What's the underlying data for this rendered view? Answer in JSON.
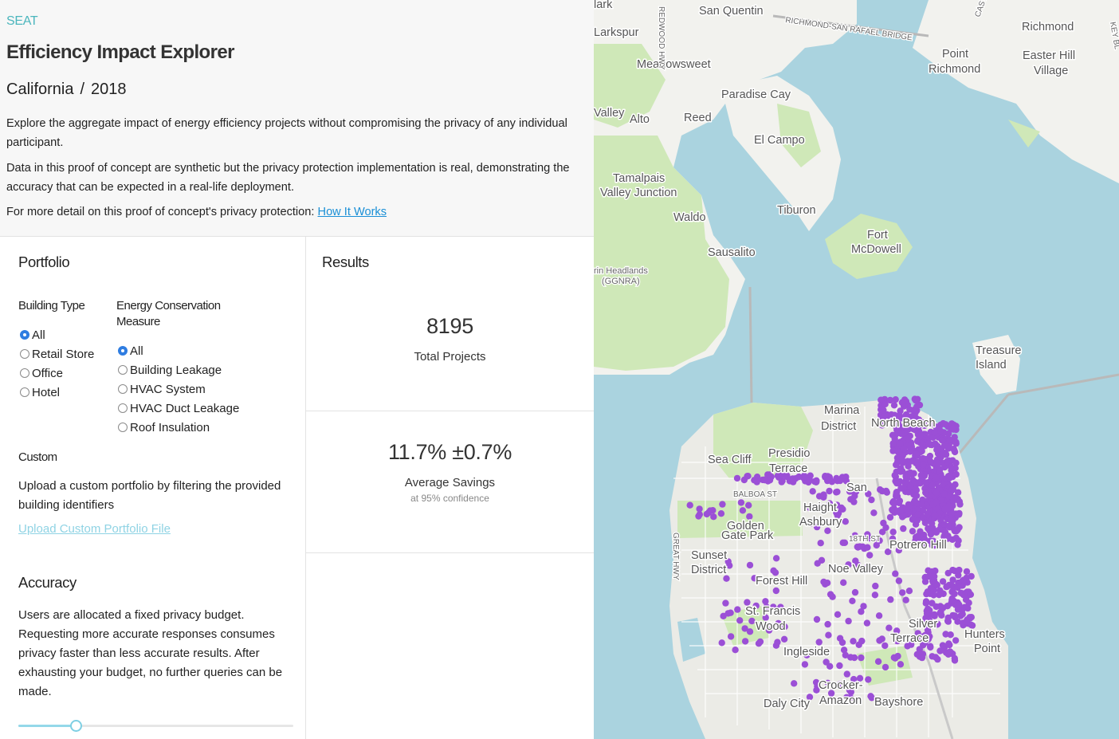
{
  "header": {
    "brand": "SEAT",
    "title": "Efficiency Impact Explorer",
    "region": "California",
    "separator": "/",
    "year": "2018",
    "intro_1": "Explore the aggregate impact of energy efficiency projects without compromising the privacy of any individual participant.",
    "intro_2": "Data in this proof of concept are synthetic but the privacy protection implementation is real, demonstrating the accuracy that can be expected in a real-life deployment.",
    "intro_3_prefix": "For more detail on this proof of concept's privacy protection:",
    "how_it_works_link": "How It Works"
  },
  "portfolio": {
    "heading": "Portfolio",
    "building_type": {
      "label": "Building Type",
      "options": [
        "All",
        "Retail Store",
        "Office",
        "Hotel"
      ],
      "selected": "All"
    },
    "ecm": {
      "label": "Energy Conservation Measure",
      "options": [
        "All",
        "Building Leakage",
        "HVAC System",
        "HVAC Duct Leakage",
        "Roof Insulation"
      ],
      "selected": "All"
    },
    "custom": {
      "label": "Custom",
      "description": "Upload a custom portfolio by filtering the provided building identifiers",
      "upload_link": "Upload Custom Portfolio File"
    },
    "accuracy": {
      "heading": "Accuracy",
      "description": "Users are allocated a fixed privacy budget. Requesting more accurate responses consumes privacy faster than less accurate results. After exhausting your budget, no further queries can be made.",
      "slider_fraction": 0.21
    }
  },
  "results": {
    "heading": "Results",
    "total_projects_value": "8195",
    "total_projects_label": "Total Projects",
    "avg_savings_value": "11.7% ±0.7%",
    "avg_savings_label": "Average Savings",
    "confidence_note": "at 95% confidence"
  },
  "map": {
    "labels": [
      "San Quentin",
      "Larkspur",
      "Meadowsweet",
      "Paradise Cay",
      "Reed",
      "Alto",
      "El Campo",
      "Tamalpais",
      "Valley Junction",
      "Waldo",
      "Tiburon",
      "Fort",
      "McDowell",
      "Sausalito",
      "Richmond",
      "Point",
      "Richmond",
      "Easter Hill",
      "Village",
      "Treasure",
      "Island",
      "Marina",
      "District",
      "North Beach",
      "Presidio",
      "Terrace",
      "Sea Cliff",
      "San",
      "Haight",
      "Ashbury",
      "Golden",
      "Gate Park",
      "Sunset",
      "District",
      "Forest Hill",
      "Noe Valley",
      "Potrero Hill",
      "St. Francis",
      "Wood",
      "Silver",
      "Terrace",
      "Hunters",
      "Point",
      "Ingleside",
      "Crocker-",
      "Amazon",
      "Daly City",
      "Bayshore",
      "Valley",
      "rin Headlands",
      "(GGNRA)",
      "lark"
    ],
    "small_labels": [
      "RICHMOND-SAN RAFAEL BRIDGE",
      "BALBOA ST",
      "REDWOOD HWY",
      "CASTRO ST",
      "KEY BL",
      "GREAT HWY",
      "18TH ST"
    ],
    "colors": {
      "water": "#aad3df",
      "land": "#f2f2ee",
      "park": "#cfe8b8",
      "points": "#9b4fd6"
    }
  }
}
